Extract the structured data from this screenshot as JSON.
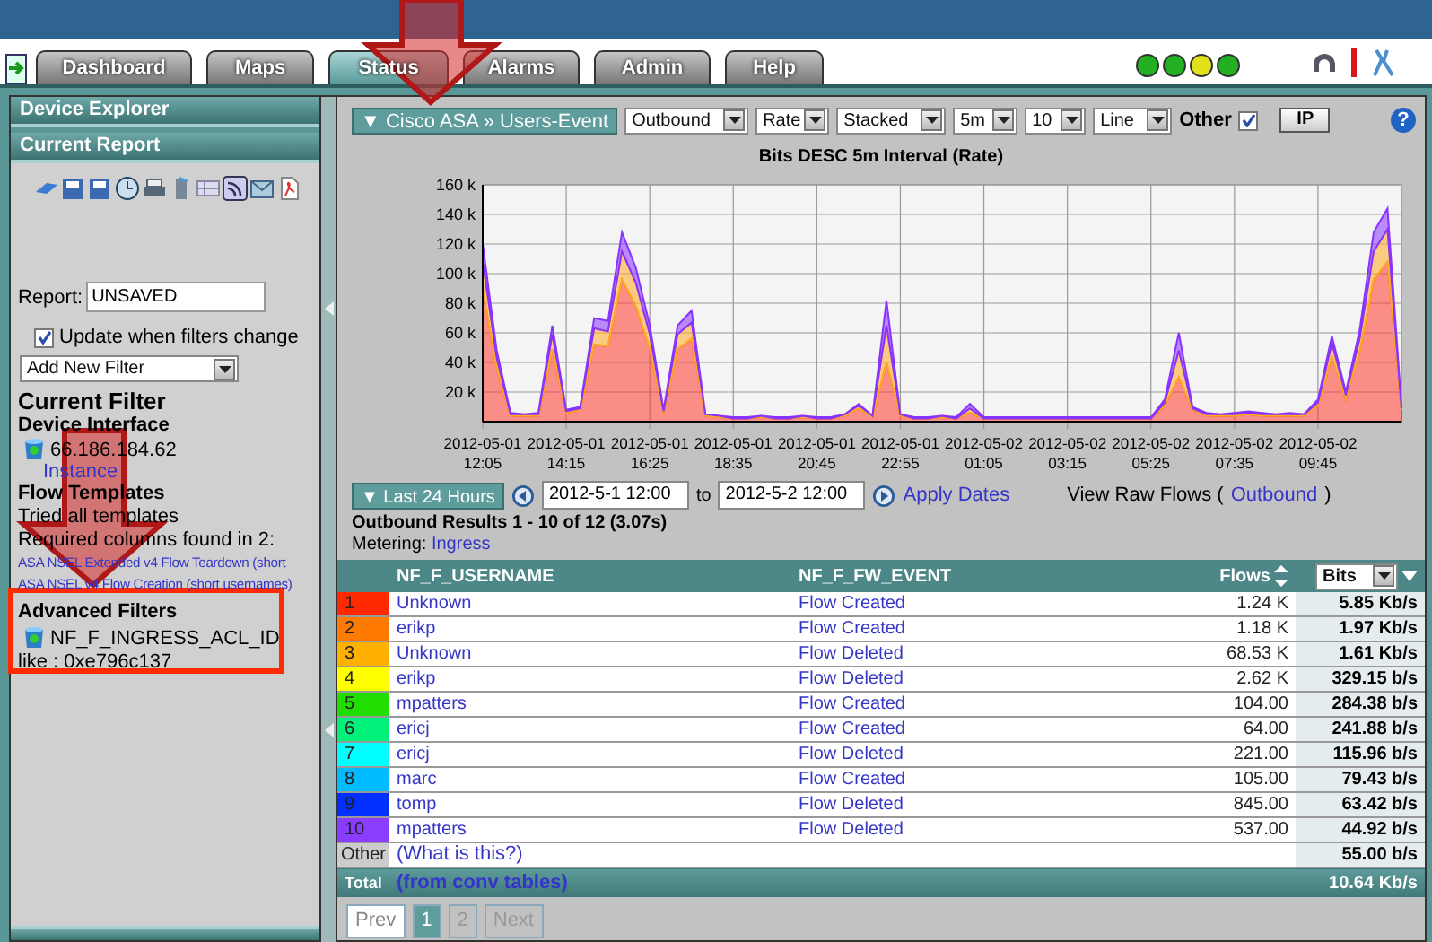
{
  "header": {
    "tabs": [
      {
        "label": "Dashboard",
        "selected": false
      },
      {
        "label": "Maps",
        "selected": false
      },
      {
        "label": "Status",
        "selected": true
      },
      {
        "label": "Alarms",
        "selected": false
      },
      {
        "label": "Admin",
        "selected": false
      },
      {
        "label": "Help",
        "selected": false
      }
    ],
    "status_lights": [
      {
        "color": "#22b022"
      },
      {
        "color": "#22b022"
      },
      {
        "color": "#e2e21c"
      },
      {
        "color": "#22b022"
      }
    ]
  },
  "sidebar": {
    "sections": [
      {
        "title": "Device Explorer"
      },
      {
        "title": "Current Report"
      }
    ],
    "report": {
      "label": "Report:",
      "value": "UNSAVED"
    },
    "update_when_filters_change": {
      "label": "Update when filters change",
      "checked": true
    },
    "add_filter": {
      "value": "Add New Filter"
    },
    "current_filter": {
      "title": "Current Filter",
      "device_heading": "Device Interface",
      "device": "66.186.184.62",
      "instance_link": "Instance",
      "templates_heading": "Flow Templates",
      "templates_note": "Tried all templates",
      "columns_note": "Required columns found in 2:",
      "templates": [
        "ASA NSEL Extended v4 Flow Teardown (short",
        "ASA NSEL v4 Flow Creation (short usernames)"
      ]
    },
    "advanced_filters": {
      "title": "Advanced Filters",
      "field": "NF_F_INGRESS_ACL_ID",
      "condition": "like : 0xe796c137"
    }
  },
  "report": {
    "source": "▼ Cisco ASA » Users-Event",
    "selects": [
      "Outbound",
      "Rate",
      "Stacked",
      "5m",
      "10",
      "Line"
    ],
    "other": {
      "label": "Other",
      "checked": true
    },
    "ip_button": "IP",
    "help": "?",
    "chart": {
      "chart_data": {
        "type": "area",
        "title": "Bits DESC 5m Interval (Rate)",
        "stacked": true,
        "grid": true,
        "categories": [
          "2012-05-01 12:05",
          null,
          null,
          null,
          null,
          null,
          "2012-05-01 14:15",
          null,
          null,
          null,
          null,
          null,
          "2012-05-01 16:25",
          null,
          null,
          null,
          null,
          null,
          "2012-05-01 18:35",
          null,
          null,
          null,
          null,
          null,
          "2012-05-01 20:45",
          null,
          null,
          null,
          null,
          null,
          "2012-05-01 22:55",
          null,
          null,
          null,
          null,
          null,
          "2012-05-02 01:05",
          null,
          null,
          null,
          null,
          null,
          "2012-05-02 03:15",
          null,
          null,
          null,
          null,
          null,
          "2012-05-02 05:25",
          null,
          null,
          null,
          null,
          null,
          "2012-05-02 07:35",
          null,
          null,
          null,
          null,
          null,
          "2012-05-02 09:45",
          null,
          null,
          null,
          null,
          null,
          null
        ],
        "ylim": [
          0,
          160
        ],
        "yticks": [
          {
            "value": 20,
            "label": "20 k"
          },
          {
            "value": 40,
            "label": "40 k"
          },
          {
            "value": 60,
            "label": "60 k"
          },
          {
            "value": 80,
            "label": "80 k"
          },
          {
            "value": 100,
            "label": "100 k"
          },
          {
            "value": 120,
            "label": "120 k"
          },
          {
            "value": 140,
            "label": "140 k"
          },
          {
            "value": 160,
            "label": "160 k"
          }
        ],
        "series": [
          {
            "color": "#ff3b2b",
            "values": [
              90,
              36,
              4,
              4,
              4,
              49,
              6,
              8,
              52,
              51,
              96,
              78,
              49,
              6,
              49,
              56,
              4,
              3,
              2,
              2,
              3,
              2,
              2,
              3,
              2,
              2,
              4,
              9,
              3,
              40,
              4,
              2,
              2,
              3,
              2,
              6,
              2,
              2,
              2,
              2,
              2,
              2,
              2,
              2,
              2,
              2,
              2,
              2,
              2,
              11,
              30,
              8,
              4,
              4,
              4,
              5,
              4,
              4,
              4,
              4,
              11,
              44,
              15,
              47,
              96,
              108,
              8
            ]
          },
          {
            "color": "#ffaa22",
            "values": [
              18,
              7,
              1,
              1,
              1,
              10,
              1,
              1,
              11,
              10,
              19,
              16,
              10,
              1,
              10,
              11,
              1,
              1,
              0,
              0,
              1,
              0,
              0,
              1,
              0,
              0,
              1,
              2,
              1,
              25,
              1,
              0,
              0,
              1,
              0,
              3,
              0,
              0,
              0,
              0,
              0,
              0,
              0,
              0,
              0,
              0,
              0,
              0,
              0,
              2,
              18,
              1,
              1,
              1,
              1,
              1,
              1,
              1,
              1,
              1,
              2,
              9,
              3,
              9,
              19,
              22,
              1
            ]
          },
          {
            "color": "#8833ff",
            "values": [
              12,
              5,
              1,
              0,
              1,
              6,
              1,
              1,
              7,
              7,
              13,
              10,
              6,
              1,
              6,
              8,
              0,
              0,
              1,
              1,
              0,
              1,
              1,
              0,
              1,
              1,
              0,
              1,
              0,
              17,
              0,
              1,
              1,
              0,
              1,
              3,
              1,
              1,
              1,
              1,
              1,
              1,
              1,
              1,
              1,
              1,
              1,
              1,
              1,
              2,
              12,
              1,
              1,
              0,
              1,
              1,
              1,
              0,
              1,
              0,
              2,
              5,
              2,
              6,
              13,
              14,
              1
            ]
          }
        ]
      }
    },
    "dates": {
      "range": "▼ Last 24 Hours",
      "from": "2012-5-1 12:00",
      "to_label": "to",
      "to": "2012-5-2 12:00",
      "apply": "Apply Dates",
      "raw_label": "View Raw Flows (",
      "raw_link": "Outbound",
      "raw_close": ")"
    },
    "results": {
      "summary": "Outbound Results 1 - 10 of 12 (3.07s)",
      "metering_label": "Metering:",
      "metering_link": "Ingress"
    },
    "table": {
      "columns": [
        "NF_F_USERNAME",
        "NF_F_FW_EVENT",
        "Flows"
      ],
      "unit_select": "Bits",
      "rows": [
        {
          "rank": "1",
          "color": "#ff2a00",
          "user": "Unknown",
          "event": "Flow Created",
          "flows": "1.24 K",
          "rate": "5.85 Kb/s"
        },
        {
          "rank": "2",
          "color": "#ff7a00",
          "user": "erikp",
          "event": "Flow Created",
          "flows": "1.18 K",
          "rate": "1.97 Kb/s"
        },
        {
          "rank": "3",
          "color": "#ffb000",
          "user": "Unknown",
          "event": "Flow Deleted",
          "flows": "68.53 K",
          "rate": "1.61 Kb/s"
        },
        {
          "rank": "4",
          "color": "#ffff00",
          "user": "erikp",
          "event": "Flow Deleted",
          "flows": "2.62 K",
          "rate": "329.15 b/s"
        },
        {
          "rank": "5",
          "color": "#22dd00",
          "user": "mpatters",
          "event": "Flow Created",
          "flows": "104.00",
          "rate": "284.38 b/s"
        },
        {
          "rank": "6",
          "color": "#00f07a",
          "user": "ericj",
          "event": "Flow Created",
          "flows": "64.00",
          "rate": "241.88 b/s"
        },
        {
          "rank": "7",
          "color": "#00ffff",
          "user": "ericj",
          "event": "Flow Deleted",
          "flows": "221.00",
          "rate": "115.96 b/s"
        },
        {
          "rank": "8",
          "color": "#00bbff",
          "user": "marc",
          "event": "Flow Created",
          "flows": "105.00",
          "rate": "79.43 b/s"
        },
        {
          "rank": "9",
          "color": "#0030ff",
          "user": "tomp",
          "event": "Flow Deleted",
          "flows": "845.00",
          "rate": "63.42 b/s"
        },
        {
          "rank": "10",
          "color": "#8a3cff",
          "user": "mpatters",
          "event": "Flow Deleted",
          "flows": "537.00",
          "rate": "44.92 b/s"
        }
      ],
      "other": {
        "label": "Other",
        "link": "(What is this?)",
        "rate": "55.00 b/s"
      },
      "total": {
        "label": "Total",
        "link": "(from conv tables)",
        "rate": "10.64 Kb/s"
      }
    },
    "pager": {
      "prev": "Prev",
      "pages": [
        {
          "label": "1",
          "selected": true
        },
        {
          "label": "2",
          "selected": false
        }
      ],
      "next": "Next"
    }
  },
  "annotations": [
    {
      "kind": "arrow"
    },
    {
      "kind": "arrow"
    },
    {
      "kind": "frame"
    }
  ]
}
